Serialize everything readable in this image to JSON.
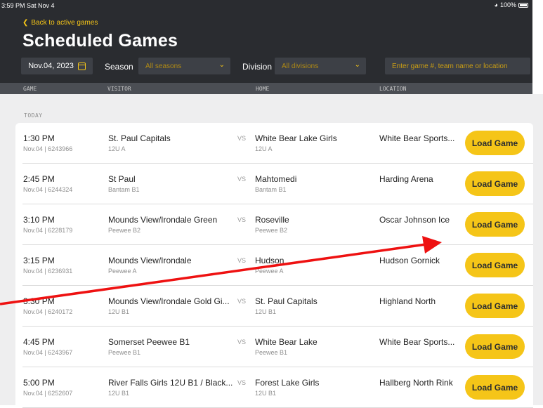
{
  "status_bar": {
    "time": "3:59 PM  Sat Nov 4",
    "battery": "100%"
  },
  "header": {
    "back_label": "Back to active games",
    "title": "Scheduled Games",
    "date": "Nov.04, 2023",
    "season_label": "Season",
    "season_value": "All seasons",
    "division_label": "Division",
    "division_value": "All divisions",
    "search_placeholder": "Enter game #, team name or location"
  },
  "columns": {
    "game": "GAME",
    "visitor": "VISITOR",
    "home": "HOME",
    "location": "LOCATION"
  },
  "section_label": "TODAY",
  "vs_label": "VS",
  "load_label": "Load Game",
  "games": [
    {
      "time": "1:30 PM",
      "meta": "Nov.04 | 6243966",
      "visitor": "St. Paul Capitals",
      "visitor_div": "12U A",
      "home": "White Bear Lake Girls",
      "home_div": "12U A",
      "location": "White Bear Sports..."
    },
    {
      "time": "2:45 PM",
      "meta": "Nov.04 | 6244324",
      "visitor": "St Paul",
      "visitor_div": "Bantam B1",
      "home": "Mahtomedi",
      "home_div": "Bantam B1",
      "location": "Harding Arena"
    },
    {
      "time": "3:10 PM",
      "meta": "Nov.04 | 6228179",
      "visitor": "Mounds View/Irondale Green",
      "visitor_div": "Peewee B2",
      "home": "Roseville",
      "home_div": "Peewee B2",
      "location": "Oscar Johnson Ice"
    },
    {
      "time": "3:15 PM",
      "meta": "Nov.04 | 6236931",
      "visitor": "Mounds View/Irondale",
      "visitor_div": "Peewee A",
      "home": "Hudson",
      "home_div": "Peewee A",
      "location": "Hudson Gornick"
    },
    {
      "time": "3:30 PM",
      "meta": "Nov.04 | 6240172",
      "visitor": "Mounds View/Irondale Gold Gi...",
      "visitor_div": "12U B1",
      "home": "St. Paul Capitals",
      "home_div": "12U B1",
      "location": "Highland North"
    },
    {
      "time": "4:45 PM",
      "meta": "Nov.04 | 6243967",
      "visitor": "Somerset Peewee B1",
      "visitor_div": "Peewee B1",
      "home": "White Bear Lake",
      "home_div": "Peewee B1",
      "location": "White Bear Sports..."
    },
    {
      "time": "5:00 PM",
      "meta": "Nov.04 | 6252607",
      "visitor": "River Falls Girls 12U B1 / Black...",
      "visitor_div": "12U B1",
      "home": "Forest Lake Girls",
      "home_div": "12U B1",
      "location": "Hallberg North Rink"
    }
  ],
  "colors": {
    "accent": "#f5c518",
    "header_bg": "#2a2c30",
    "annotation_arrow": "#ee1111"
  }
}
